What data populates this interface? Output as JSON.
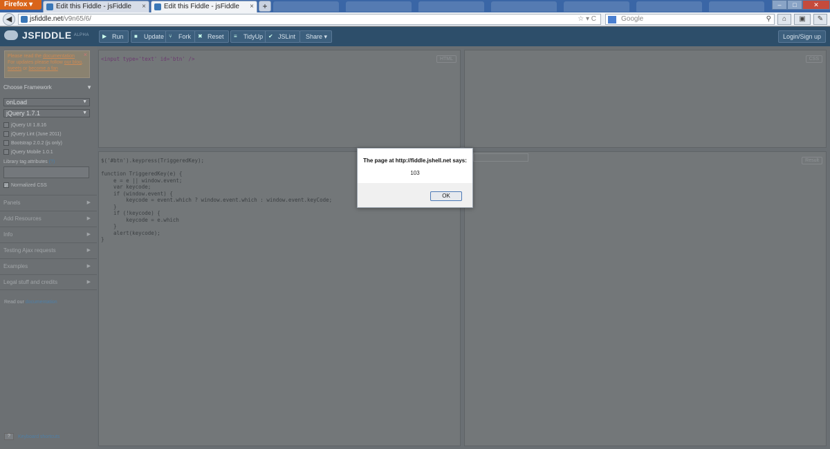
{
  "browser": {
    "menu_button": "Firefox",
    "tabs": [
      {
        "label": "Edit this Fiddle - jsFiddle",
        "active": false
      },
      {
        "label": "Edit this Fiddle - jsFiddle",
        "active": true
      }
    ],
    "new_tab": "+",
    "url_host": "jsfiddle.net",
    "url_path": "/v9n65/6/",
    "search_placeholder": "Google"
  },
  "app": {
    "logo": "JSFIDDLE",
    "logo_tag": "ALPHA",
    "toolbar": {
      "run": "Run",
      "update": "Update",
      "fork": "Fork",
      "reset": "Reset",
      "tidyup": "TidyUp",
      "jslint": "JSLint",
      "share": "Share"
    },
    "login": "Login/Sign up"
  },
  "sidebar": {
    "notice": {
      "line1a": "Please read the ",
      "line1b": "documentation",
      "line2a": "For updates please follow ",
      "line2b": "our blog",
      "line3a": "tweets",
      "line3b": " or ",
      "line3c": "become a fan"
    },
    "choose_framework": "Choose Framework",
    "onload_select": "onLoad",
    "framework_select": "jQuery 1.7.1",
    "libraries": [
      {
        "label": "jQuery UI 1.8.16",
        "checked": false
      },
      {
        "label": "jQuery Lint (June 2011)",
        "checked": false
      },
      {
        "label": "Bootstrap 2.0.2 (js only)",
        "checked": false
      },
      {
        "label": "jQuery Mobile 1.0.1",
        "checked": false
      }
    ],
    "library_tag_label": "Library tag attributes",
    "library_tag_help": "(?)",
    "normalized_css": "Normalized CSS",
    "sections": [
      "Panels",
      "Add Resources",
      "Info",
      "Testing Ajax requests",
      "Examples",
      "Legal stuff and credits"
    ],
    "read_doc_a": "Read our ",
    "read_doc_b": "documentation",
    "kbd_key": "?",
    "kbd_label": "Keyboard shortcuts"
  },
  "panels": {
    "html_label": "HTML",
    "css_label": "CSS",
    "result_label": "Result",
    "html_code": "<input type='text' id='btn' />",
    "js_code": "$('#btn').keypress(TriggeredKey);\n\nfunction TriggeredKey(e) {\n    e = e || window.event;\n    var keycode;\n    if (window.event) {\n        keycode = event.which ? window.event.which : window.event.keyCode;\n    }\n    if (!keycode) {\n        keycode = e.which\n    }\n    alert(keycode);\n}"
  },
  "dialog": {
    "title": "The page at http://fiddle.jshell.net says:",
    "message": "103",
    "ok": "OK"
  }
}
